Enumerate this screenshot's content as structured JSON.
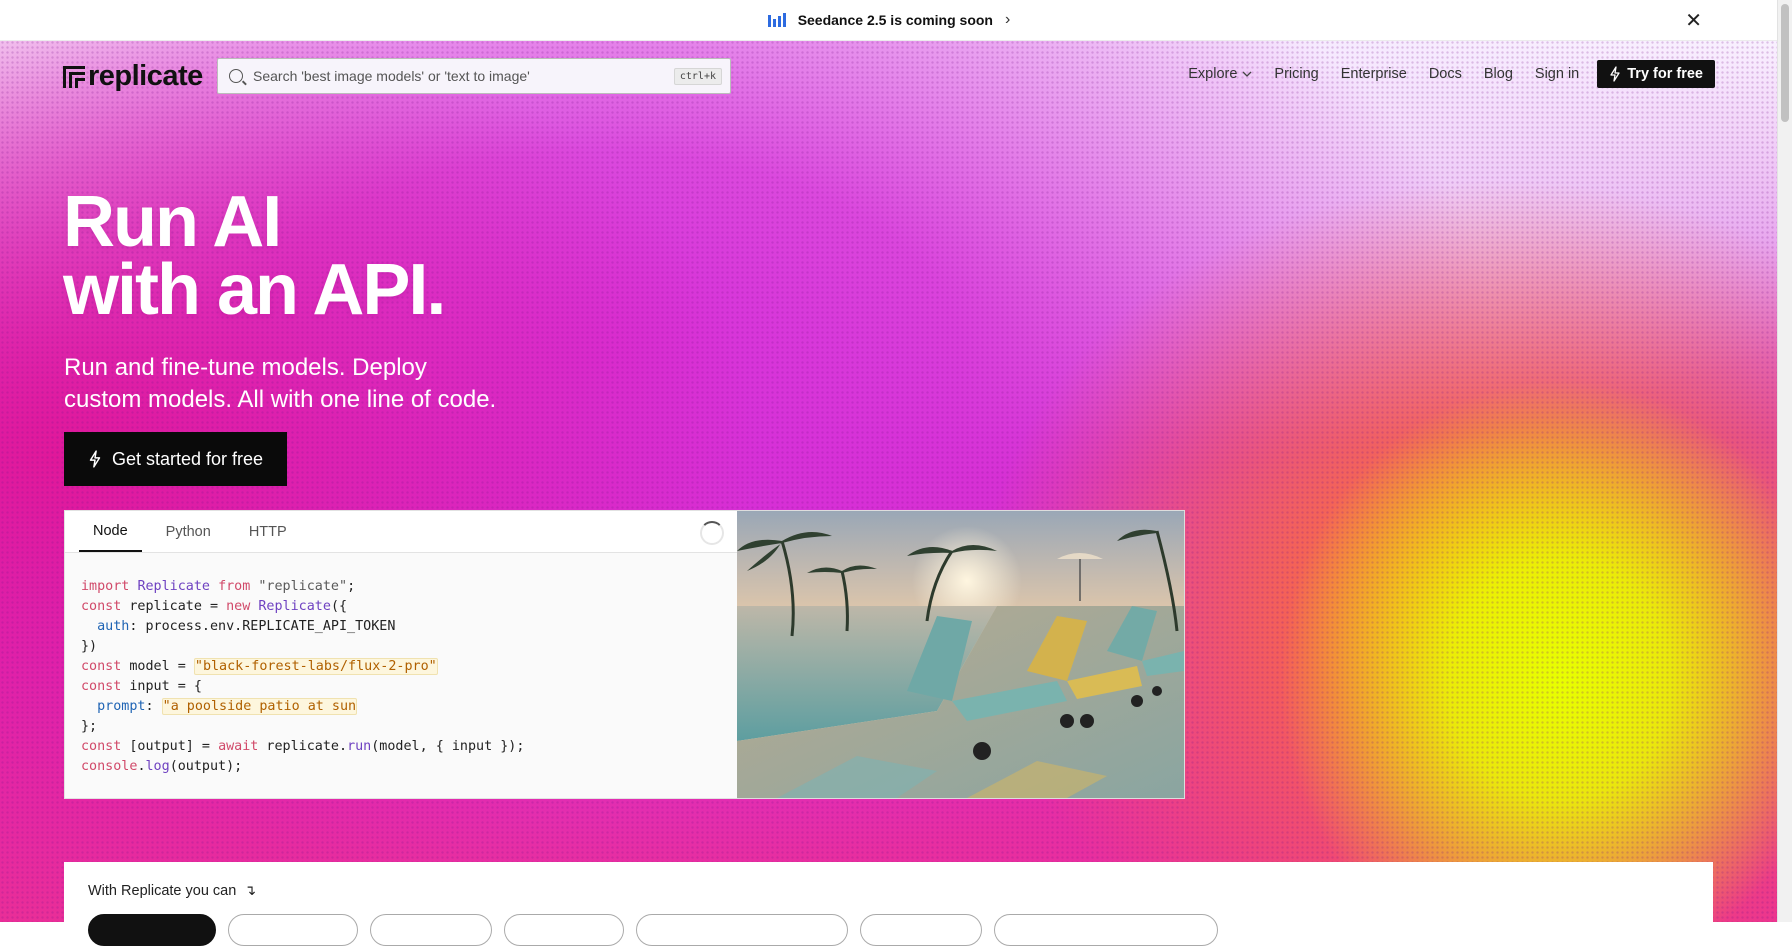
{
  "banner": {
    "text": "Seedance 2.5 is coming soon",
    "chevron": "›",
    "close": "✕"
  },
  "nav": {
    "logo": "replicate",
    "search_placeholder": "Search 'best image models' or 'text to image'",
    "shortcut": "ctrl+k",
    "links": [
      "Explore",
      "Pricing",
      "Enterprise",
      "Docs",
      "Blog",
      "Sign in"
    ],
    "cta": "Try for free"
  },
  "hero": {
    "title_line1": "Run AI",
    "title_line2": "with an API.",
    "subtitle_line1": "Run and fine-tune models. Deploy",
    "subtitle_line2": "custom models. All with one line of code.",
    "cta": "Get started for free"
  },
  "code_card": {
    "tabs": [
      "Node",
      "Python",
      "HTTP"
    ],
    "active_tab": "Node",
    "model": "black-forest-labs/flux-2-pro",
    "prompt": "a poolside patio at sun"
  },
  "bottom": {
    "label": "With Replicate you can",
    "arrow": "↴"
  },
  "colors": {
    "accent_dark": "#111111",
    "hero_magenta": "#d72fd8",
    "hero_yellow": "#e8ff00",
    "banner_icon": "#2d6be0"
  },
  "icons": [
    "bars-icon",
    "chevron-right-icon",
    "close-icon",
    "search-icon",
    "chevron-down-icon",
    "bolt-icon",
    "spinner-icon",
    "arrow-down-right-icon"
  ]
}
